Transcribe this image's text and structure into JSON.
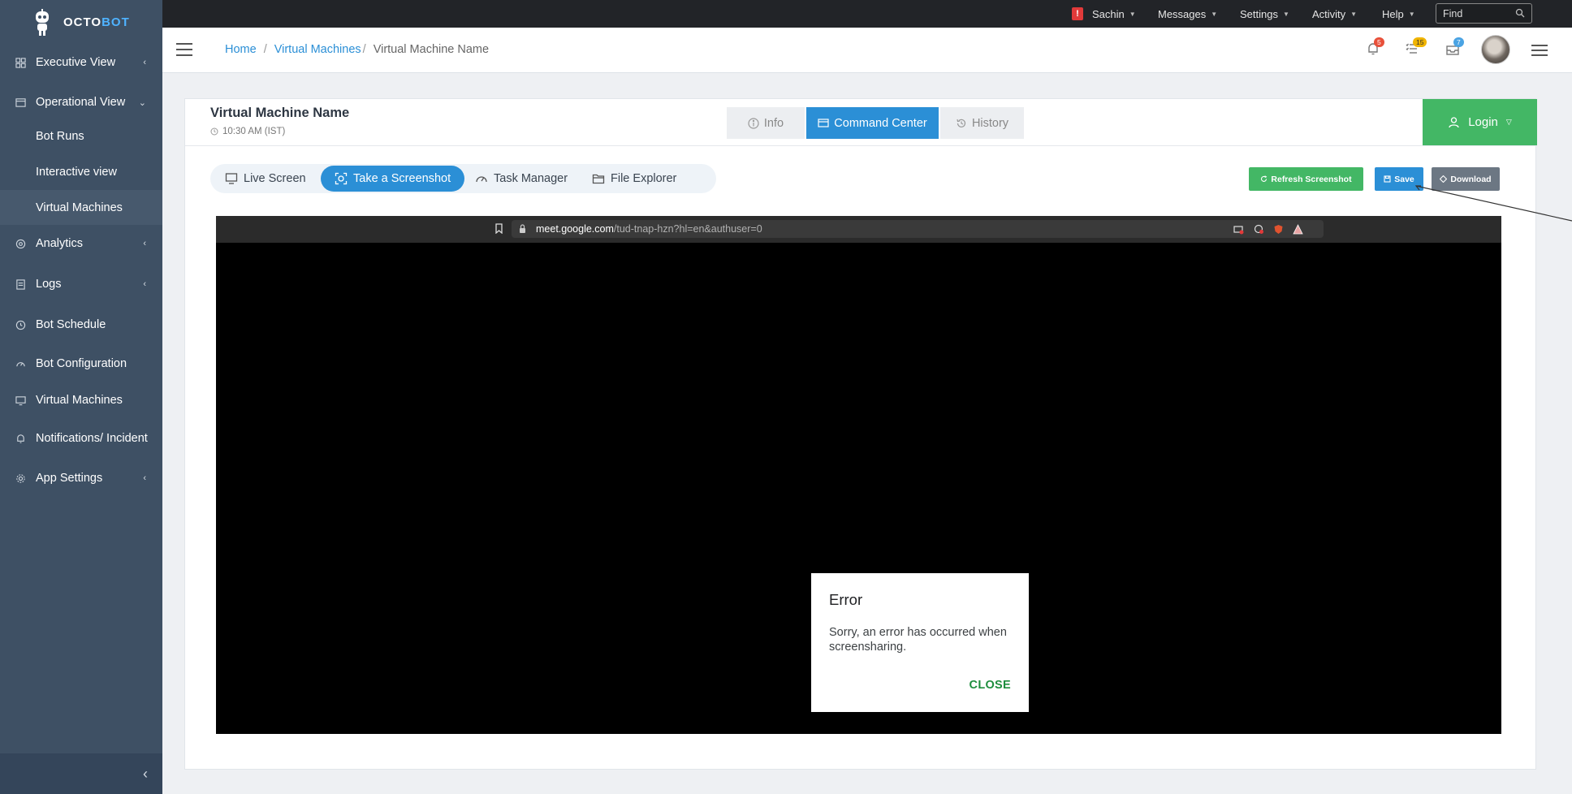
{
  "brand": {
    "name_part1": "OCTO",
    "name_part2": "BOT"
  },
  "sidebar": {
    "items": [
      {
        "label": "Executive View",
        "icon": "dashboard-icon",
        "chevron": "‹"
      },
      {
        "label": "Operational View",
        "icon": "window-icon",
        "chevron": "⌄"
      },
      {
        "label": "Analytics",
        "icon": "analytics-icon",
        "chevron": "‹"
      },
      {
        "label": "Logs",
        "icon": "logs-icon",
        "chevron": "‹"
      },
      {
        "label": "Bot Schedule",
        "icon": "clock-icon"
      },
      {
        "label": "Bot Configuration",
        "icon": "gauge-icon"
      },
      {
        "label": "Virtual Machines",
        "icon": "monitor-icon"
      },
      {
        "label": "Notifications/ Incident",
        "icon": "bell-icon"
      },
      {
        "label": "App Settings",
        "icon": "gear-icon",
        "chevron": "‹"
      }
    ],
    "subitems": [
      {
        "label": "Bot Runs"
      },
      {
        "label": "Interactive view"
      },
      {
        "label": "Virtual Machines"
      }
    ],
    "collapse": "‹"
  },
  "topbar": {
    "alert": "!",
    "user": "Sachin",
    "messages": "Messages",
    "settings": "Settings",
    "activity": "Activity",
    "help": "Help",
    "find_placeholder": "Find"
  },
  "header": {
    "breadcrumb": {
      "home": "Home",
      "section": "Virtual Machines",
      "current": "Virtual Machine Name"
    },
    "badges": {
      "notifications": "5",
      "tasks": "15",
      "messages": "7"
    }
  },
  "card": {
    "title": "Virtual Machine Name",
    "time": "10:30 AM (IST)",
    "tabs": {
      "info": "Info",
      "command_center": "Command Center",
      "history": "History"
    },
    "login": "Login"
  },
  "subtabs": {
    "live_screen": "Live Screen",
    "take_screenshot": "Take a Screenshot",
    "task_manager": "Task Manager",
    "file_explorer": "File Explorer"
  },
  "actions": {
    "refresh": "Refresh Screenshot",
    "save": "Save",
    "download": "Download"
  },
  "screenshot": {
    "url_domain": "meet.google.com",
    "url_path": "/tud-tnap-hzn?hl=en&authuser=0",
    "dialog": {
      "title": "Error",
      "message": "Sorry, an error has occurred when screensharing.",
      "close": "CLOSE"
    }
  },
  "colors": {
    "sidebar": "#3e5064",
    "accent": "#2b8fd6",
    "success": "#43b765",
    "topbar": "#222428"
  }
}
